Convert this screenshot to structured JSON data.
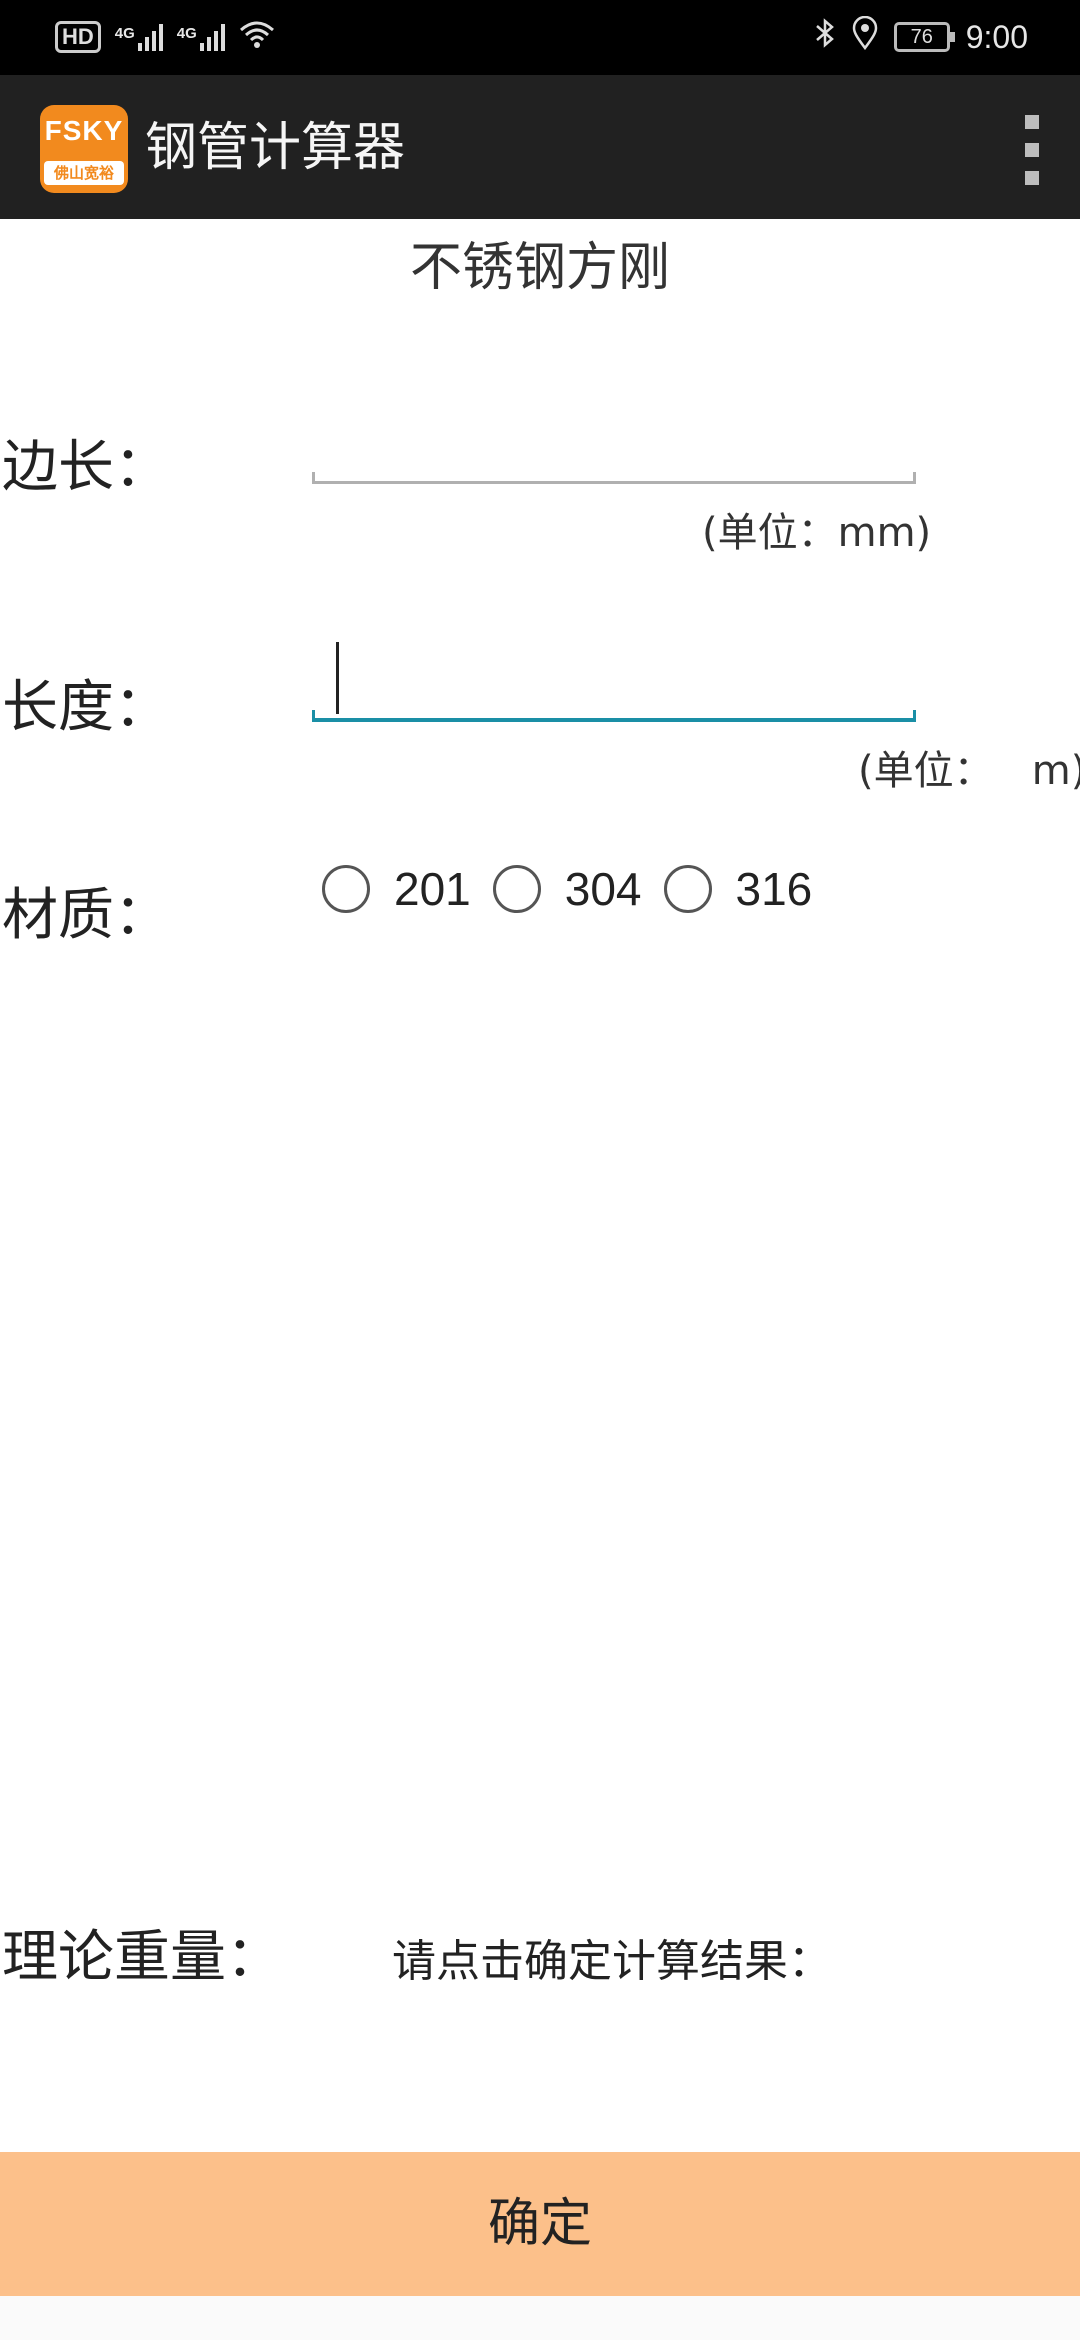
{
  "status_bar": {
    "hd_label": "HD",
    "network1": "4G",
    "network2": "4G",
    "battery": "76",
    "time": "9:00",
    "icons": [
      "hd-icon",
      "signal-icon",
      "signal-icon",
      "wifi-icon",
      "bluetooth-icon",
      "location-icon",
      "battery-icon"
    ]
  },
  "app_bar": {
    "logo_line1": "FSKY",
    "logo_line2": "佛山宽裕",
    "title": "钢管计算器",
    "menu_icon": "overflow-menu-icon"
  },
  "main": {
    "heading": "不锈钢方刚",
    "side_label": "边长：",
    "side_value": "",
    "side_unit": "(单位：mm)",
    "length_label": "长度：",
    "length_value": "",
    "length_unit": "(单位：   m)",
    "material_label": "材质：",
    "materials": [
      "201",
      "304",
      "316"
    ],
    "weight_label": "理论重量：",
    "weight_result": "请点击确定计算结果："
  },
  "actions": {
    "confirm_label": "确定"
  },
  "colors": {
    "status_bg": "#000000",
    "appbar_bg": "#212121",
    "logo_orange": "#f28a1e",
    "active_underline": "#1a8fa6",
    "confirm_bg": "#fcc08a"
  }
}
